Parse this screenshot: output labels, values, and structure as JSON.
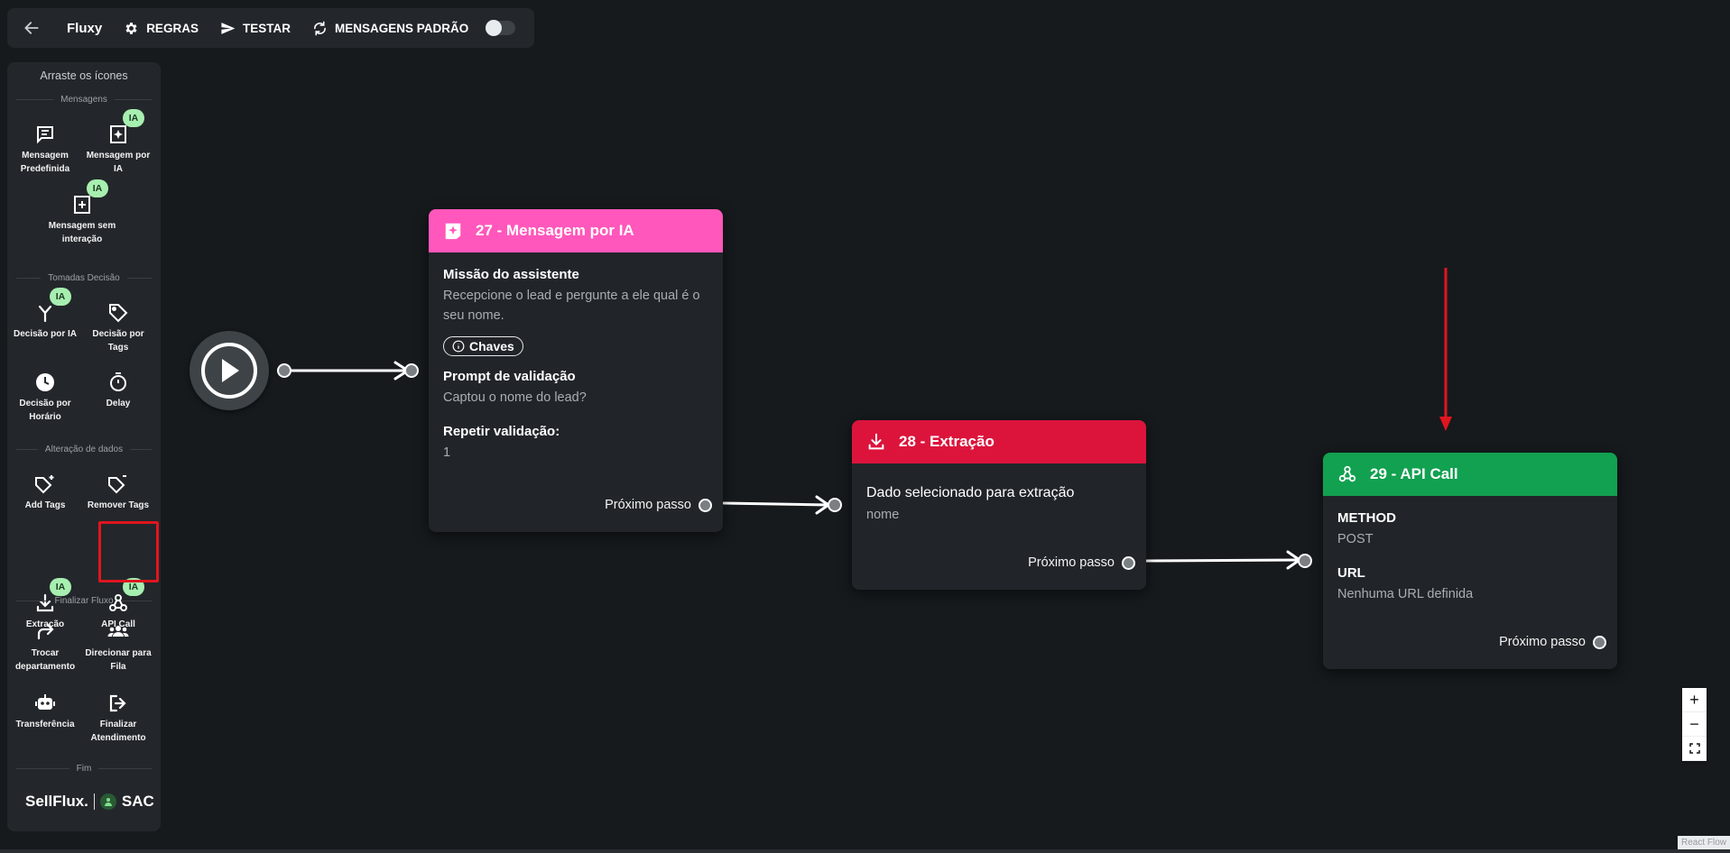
{
  "toolbar": {
    "title": "Fluxy",
    "rules_label": "REGRAS",
    "test_label": "TESTAR",
    "default_messages_label": "MENSAGENS PADRÃO",
    "default_messages_enabled": false
  },
  "sidebar": {
    "header": "Arraste os ícones",
    "sections": {
      "messages": "Mensagens",
      "decisions": "Tomadas Decisão",
      "data_changes": "Alteração de dados",
      "finish": "Finalizar Fluxo",
      "end": "Fim"
    },
    "tools": {
      "predefined_message": "Mensagem Predefinida",
      "ai_message": "Mensagem por IA",
      "no_interaction_message": "Mensagem sem interação",
      "ai_decision": "Decisão por IA",
      "tags_decision": "Decisão por Tags",
      "time_decision": "Decisão por Horário",
      "delay": "Delay",
      "add_tags": "Add Tags",
      "remove_tags": "Remover Tags",
      "extraction": "Extração",
      "api_call": "API Call",
      "change_department": "Trocar departamento",
      "queue": "Direcionar para Fila",
      "transfer": "Transferência",
      "finish_service": "Finalizar Atendimento"
    },
    "ia_badge": "IA",
    "brand": {
      "left": "SellFlux.",
      "right": "SAC"
    }
  },
  "nodes": {
    "ai_message": {
      "title": "27 - Mensagem por IA",
      "color": "#ff57bb",
      "mission_label": "Missão do assistente",
      "mission_value": "Recepcione o lead e pergunte a ele qual é o seu nome.",
      "keys_chip": "Chaves",
      "prompt_label": "Prompt de validação",
      "prompt_value": "Captou o nome do lead?",
      "repeat_label": "Repetir validação:",
      "repeat_value": "1",
      "next_label": "Próximo passo"
    },
    "extraction": {
      "title": "28 - Extração",
      "color": "#dc143c",
      "data_label": "Dado selecionado para extração",
      "data_value": "nome",
      "next_label": "Próximo passo"
    },
    "api_call": {
      "title": "29 - API Call",
      "color": "#12a150",
      "method_label": "METHOD",
      "method_value": "POST",
      "url_label": "URL",
      "url_value": "Nenhuma URL definida",
      "next_label": "Próximo passo"
    }
  },
  "zoom": {
    "in": "+",
    "out": "−"
  },
  "attribution": "React Flow"
}
